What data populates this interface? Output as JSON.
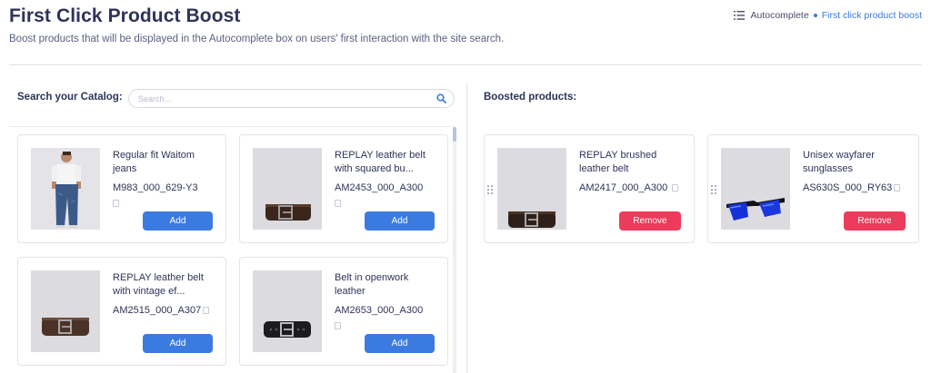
{
  "header": {
    "title": "First Click Product Boost",
    "subtitle": "Boost products that will be displayed in the Autocomplete box on users' first interaction with the site search.",
    "breadcrumb": {
      "parent": "Autocomplete",
      "current": "First click product boost"
    }
  },
  "catalog": {
    "label": "Search your Catalog:",
    "search_placeholder": "Search...",
    "search_value": "",
    "add_label": "Add",
    "products": [
      {
        "name": "Regular fit Waitom jeans",
        "sku": "M983_000_629-Y3",
        "image": "jeans-model"
      },
      {
        "name": "REPLAY leather belt with squared bu...",
        "sku": "AM2453_000_A300",
        "image": "brown-belt"
      },
      {
        "name": "REPLAY leather belt with vintage ef...",
        "sku": "AM2515_000_A307",
        "image": "brown-belt"
      },
      {
        "name": "Belt in openwork leather",
        "sku": "AM2653_000_A300",
        "image": "black-belt"
      }
    ]
  },
  "boosted": {
    "label": "Boosted products:",
    "remove_label": "Remove",
    "products": [
      {
        "name": "REPLAY brushed leather belt",
        "sku": "AM2417_000_A300",
        "image": "brown-belt"
      },
      {
        "name": "Unisex wayfarer sunglasses",
        "sku": "AS630S_000_RY63",
        "image": "sunglasses"
      }
    ]
  },
  "colors": {
    "primary": "#3b7be0",
    "danger": "#ec3b5b",
    "title": "#2e3358"
  }
}
